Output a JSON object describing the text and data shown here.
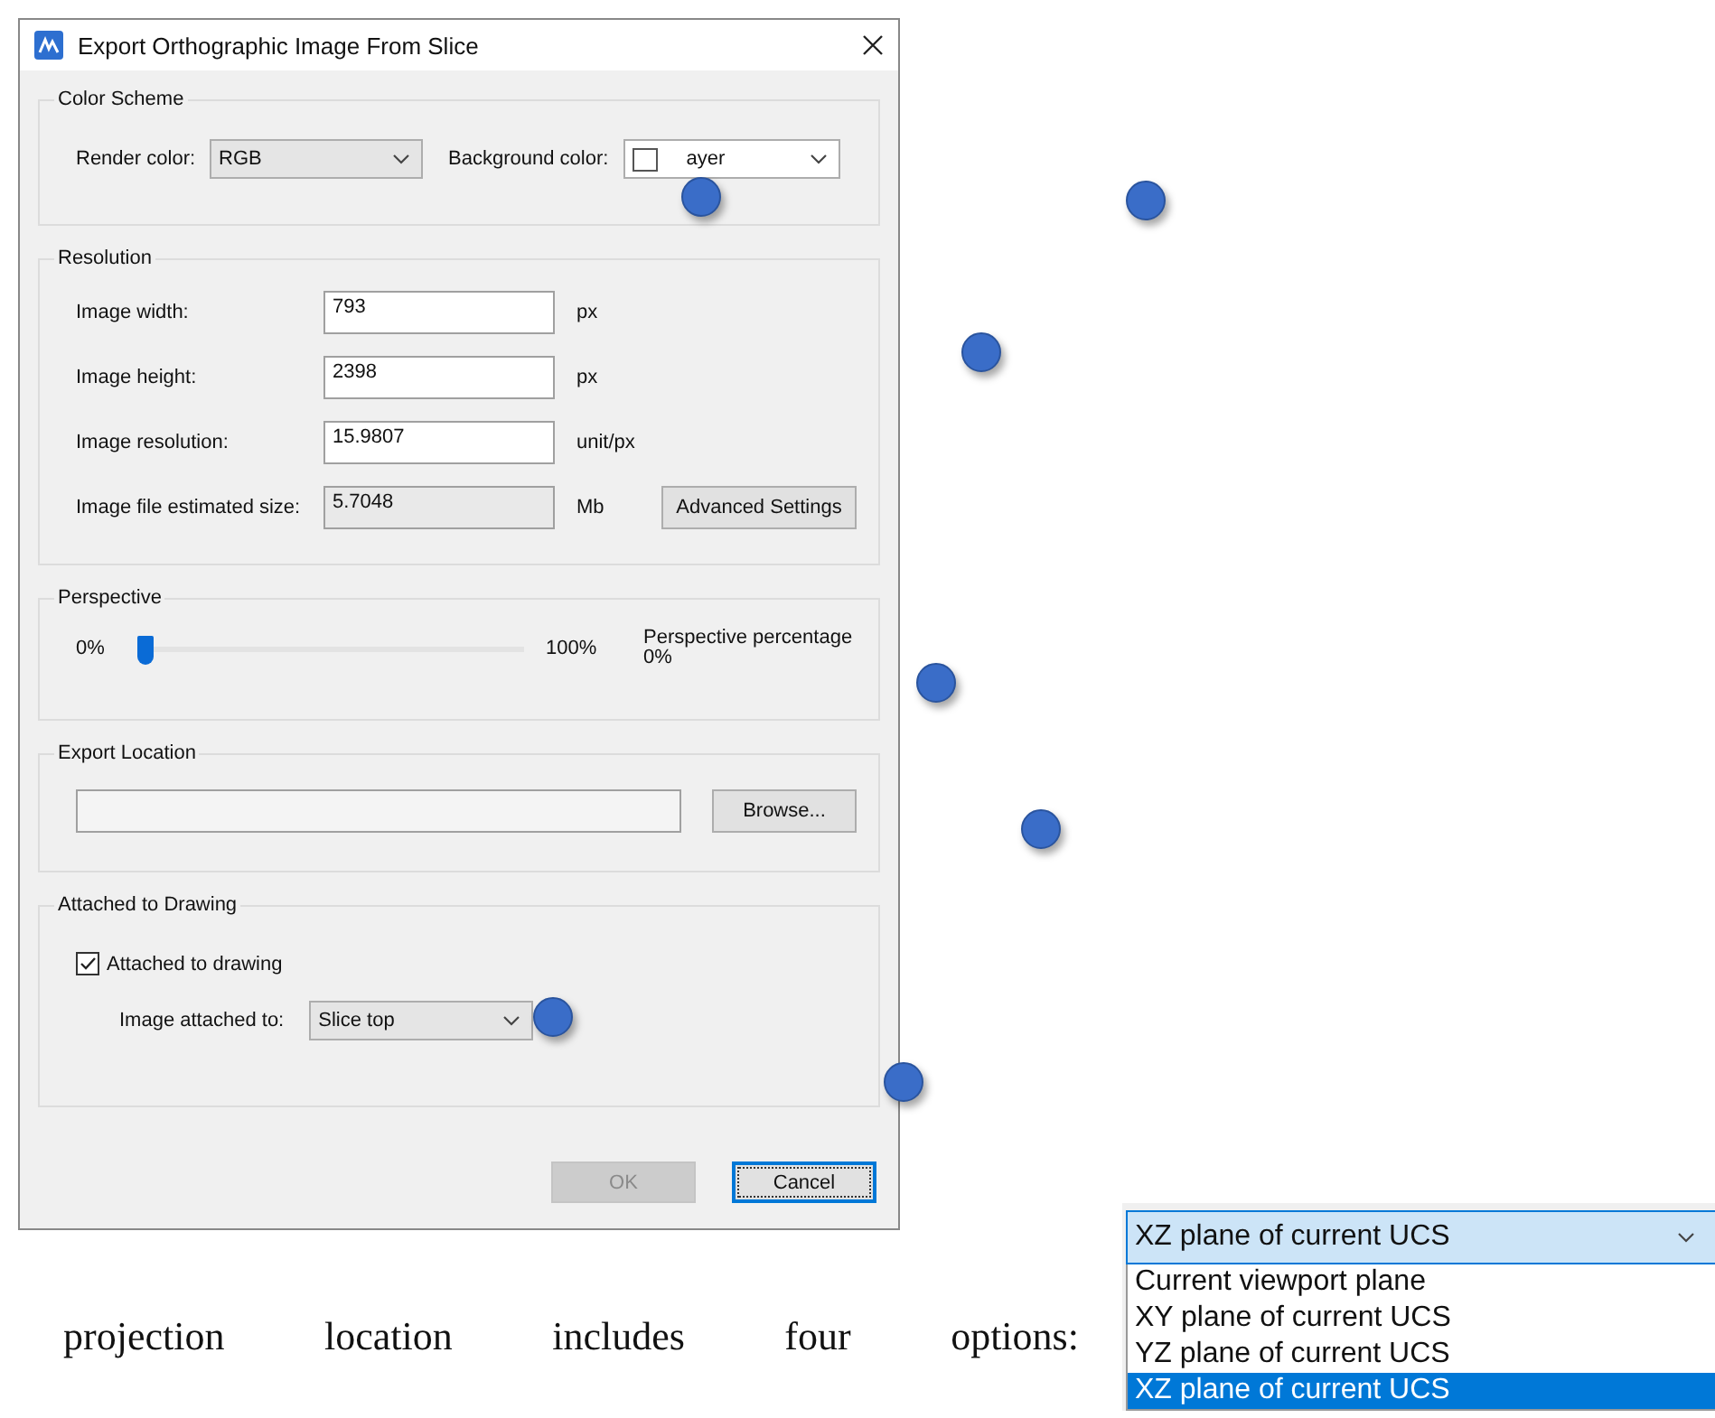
{
  "window": {
    "title": "Export Orthographic Image From Slice"
  },
  "color_scheme": {
    "title": "Color Scheme",
    "render_label": "Render color:",
    "render_value": "RGB",
    "background_label": "Background color:",
    "background_value": "ayer"
  },
  "resolution": {
    "title": "Resolution",
    "rows": [
      {
        "label": "Image width:",
        "value": "793",
        "unit": "px",
        "readonly": false
      },
      {
        "label": "Image height:",
        "value": "2398",
        "unit": "px",
        "readonly": false
      },
      {
        "label": "Image resolution:",
        "value": "15.9807",
        "unit": "unit/px",
        "readonly": false
      },
      {
        "label": "Image file estimated size:",
        "value": "5.7048",
        "unit": "Mb",
        "readonly": true
      }
    ],
    "button": "Advanced Settings"
  },
  "perspective": {
    "title": "Perspective",
    "min_label": "0%",
    "max_label": "100%",
    "level": 0,
    "reading_label": "Perspective percentage",
    "reading": "0%"
  },
  "export_location": {
    "title": "Export Location",
    "button": "Browse..."
  },
  "attached": {
    "title": "Attached to Drawing",
    "checkbox": {
      "label": "Attached to drawing",
      "checked": true
    },
    "target_label": "Image attached to:",
    "target_value": "Slice top"
  },
  "buttons": [
    {
      "label": "OK",
      "disabled": true,
      "focused": false
    },
    {
      "label": "Cancel",
      "disabled": false,
      "focused": true
    }
  ],
  "body_text": "projection location includes four options:",
  "projection_dropdown": {
    "value": "XZ plane of current UCS",
    "options": [
      {
        "label": "Current viewport plane",
        "selected": false
      },
      {
        "label": "XY plane of current UCS",
        "selected": false
      },
      {
        "label": "YZ plane of current UCS",
        "selected": false
      },
      {
        "label": "XZ plane of current UCS",
        "selected": true
      }
    ]
  }
}
